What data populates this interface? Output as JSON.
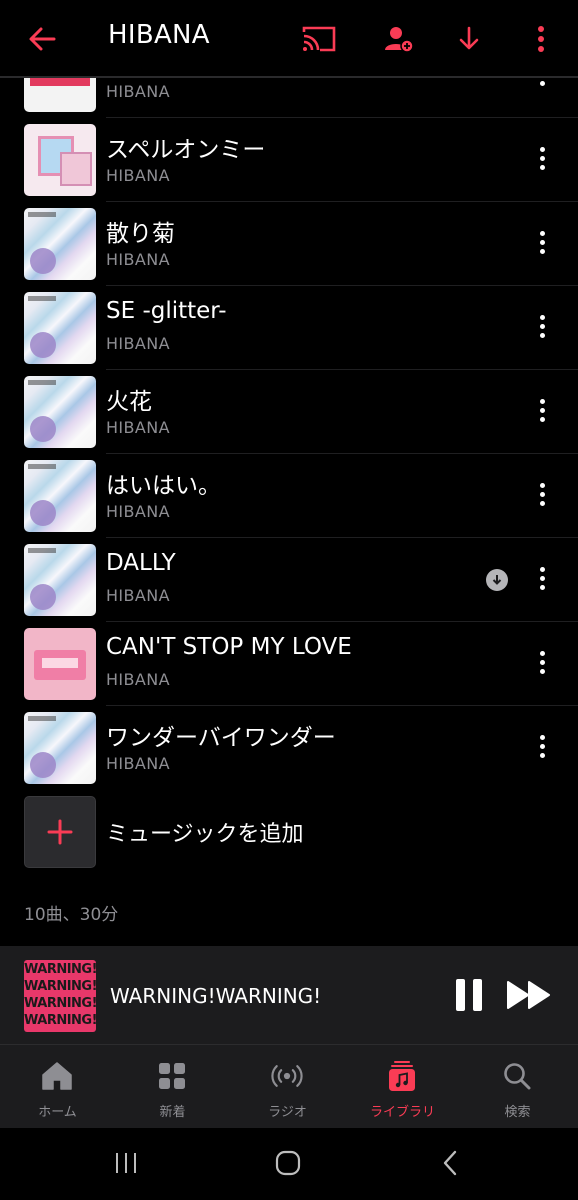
{
  "header": {
    "title": "HIBANA"
  },
  "songs": [
    {
      "title": "",
      "artist": "HIBANA",
      "art": "top",
      "downloaded": true
    },
    {
      "title": "スペルオンミー",
      "artist": "HIBANA",
      "art": "spell",
      "downloaded": false
    },
    {
      "title": "散り菊",
      "artist": "HIBANA",
      "art": "hibana",
      "downloaded": false
    },
    {
      "title": "SE -glitter-",
      "artist": "HIBANA",
      "art": "hibana",
      "downloaded": false
    },
    {
      "title": "火花",
      "artist": "HIBANA",
      "art": "hibana",
      "downloaded": false
    },
    {
      "title": "はいはい。",
      "artist": "HIBANA",
      "art": "hibana",
      "downloaded": false
    },
    {
      "title": "DALLY",
      "artist": "HIBANA",
      "art": "hibana",
      "downloaded": true
    },
    {
      "title": "CAN'T STOP MY LOVE",
      "artist": "HIBANA",
      "art": "cant",
      "downloaded": false
    },
    {
      "title": "ワンダーバイワンダー",
      "artist": "HIBANA",
      "art": "hibana",
      "downloaded": false
    }
  ],
  "add_music": {
    "label": "ミュージックを追加"
  },
  "summary": "10曲、30分",
  "now_playing": {
    "title": "WARNING!WARNING!",
    "art_text": "WARNING!"
  },
  "tabs": [
    {
      "label": "ホーム",
      "icon": "home-icon",
      "active": false
    },
    {
      "label": "新着",
      "icon": "grid-icon",
      "active": false
    },
    {
      "label": "ラジオ",
      "icon": "radio-icon",
      "active": false
    },
    {
      "label": "ライブラリ",
      "icon": "library-icon",
      "active": true
    },
    {
      "label": "検索",
      "icon": "search-icon",
      "active": false
    }
  ],
  "colors": {
    "accent": "#fa3c55",
    "background": "#000000",
    "secondary_text": "#8e8e93"
  }
}
